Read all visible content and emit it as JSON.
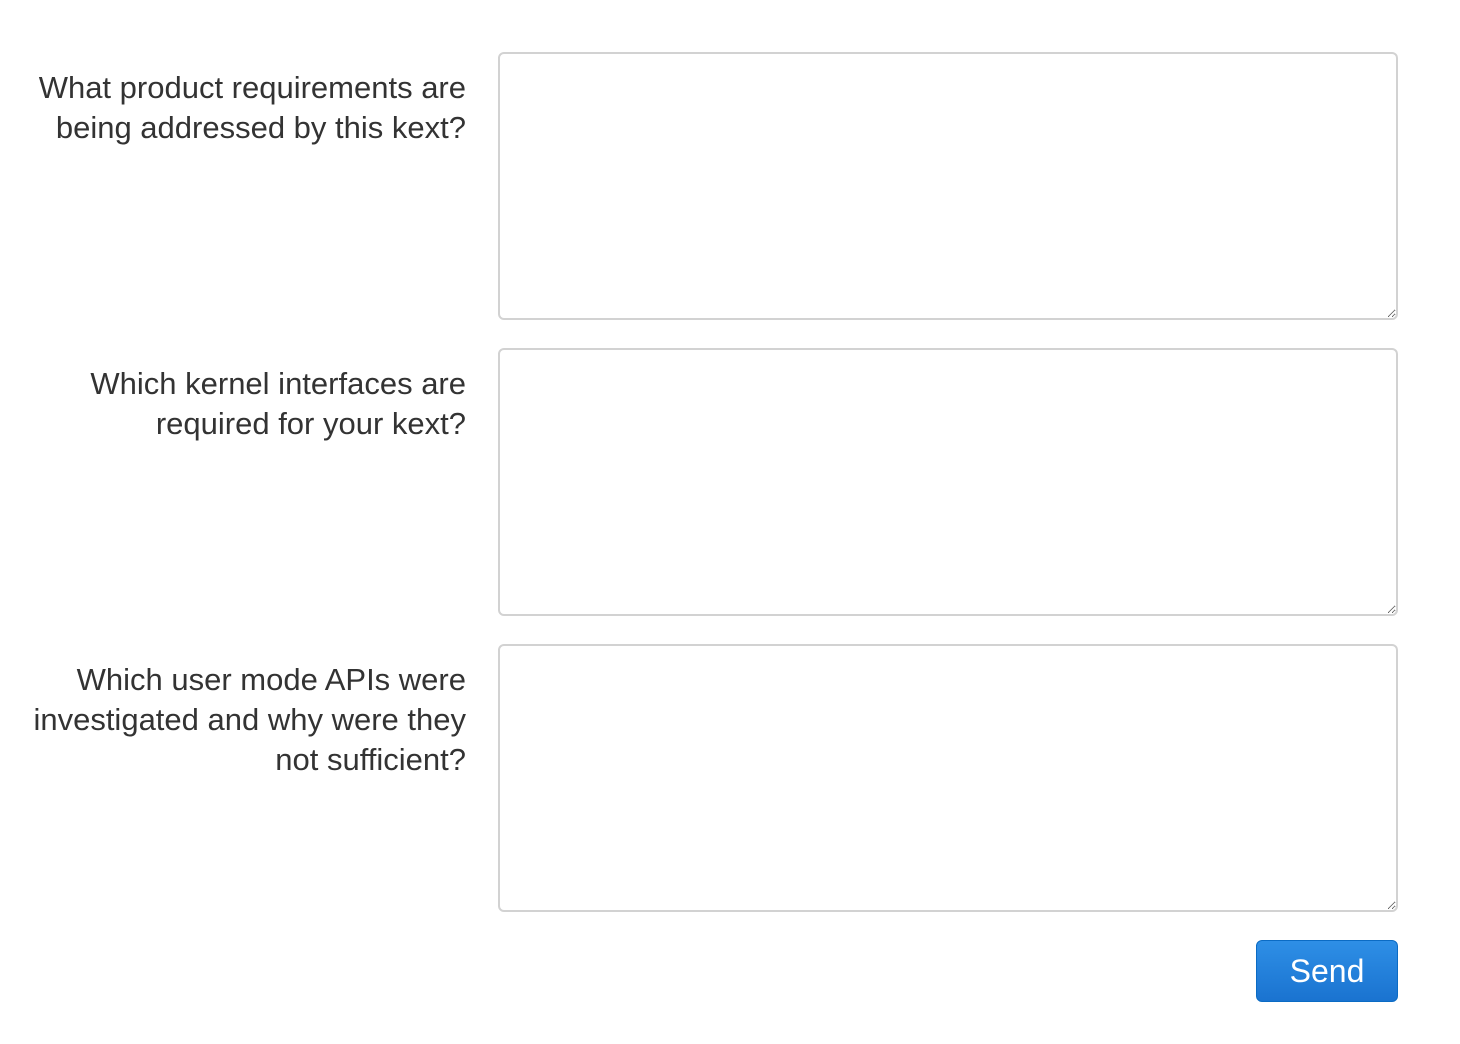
{
  "form": {
    "fields": [
      {
        "label": "What product requirements are being addressed by this kext?",
        "value": ""
      },
      {
        "label": "Which kernel interfaces are required for your kext?",
        "value": ""
      },
      {
        "label": "Which user mode APIs were investigated and why were they not sufficient?",
        "value": ""
      }
    ],
    "send_label": "Send"
  },
  "colors": {
    "button_blue": "#1a73d0",
    "border_gray": "#d2d2d2",
    "text": "#333333"
  }
}
